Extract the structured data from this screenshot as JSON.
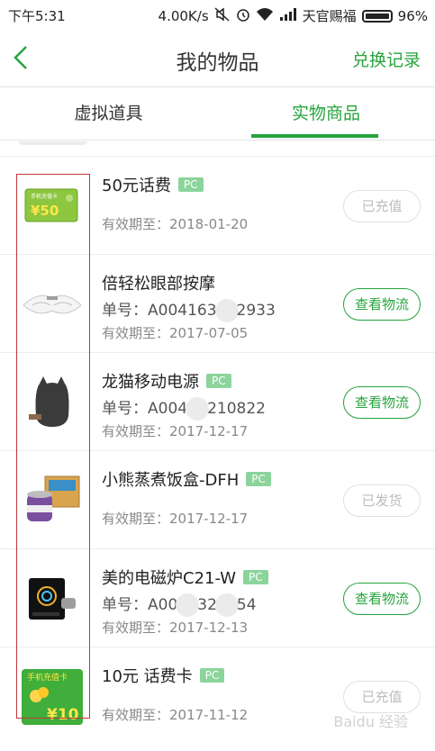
{
  "status_bar": {
    "time": "下午5:31",
    "speed": "4.00K/s",
    "carrier": "天官赐福",
    "battery": "96%"
  },
  "header": {
    "title": "我的物品",
    "right_link": "兑换记录"
  },
  "tabs": [
    {
      "label": "虚拟道具",
      "active": false
    },
    {
      "label": "实物商品",
      "active": true
    }
  ],
  "items": [
    {
      "name": "50元话费",
      "pc_badge": "PC",
      "order_prefix": "",
      "order_suffix": "",
      "expiry": "有效期至：2018-01-20",
      "button": "已充值",
      "button_style": "disabled",
      "icon": "recharge-card-50-icon"
    },
    {
      "name": "倍轻松眼部按摩",
      "pc_badge": "",
      "order_prefix": "单号：A004163",
      "order_suffix": "2933",
      "expiry": "有效期至：2017-07-05",
      "button": "查看物流",
      "button_style": "active",
      "icon": "eye-massager-icon"
    },
    {
      "name": "龙猫移动电源",
      "pc_badge": "PC",
      "order_prefix": "单号：A004",
      "order_suffix": "210822",
      "expiry": "有效期至：2017-12-17",
      "button": "查看物流",
      "button_style": "active",
      "icon": "totoro-power-bank-icon"
    },
    {
      "name": "小熊蒸煮饭盒-DFH",
      "pc_badge": "PC",
      "order_prefix": "",
      "order_suffix": "",
      "expiry": "有效期至：2017-12-17",
      "button": "已发货",
      "button_style": "disabled",
      "icon": "lunch-box-icon"
    },
    {
      "name": "美的电磁炉C21-W",
      "pc_badge": "PC",
      "order_prefix": "单号：A00",
      "order_suffix": "32",
      "order_suffix2": "54",
      "expiry": "有效期至：2017-12-13",
      "button": "查看物流",
      "button_style": "active",
      "icon": "induction-cooker-icon"
    },
    {
      "name": "10元 话费卡",
      "pc_badge": "PC",
      "order_prefix": "",
      "order_suffix": "",
      "expiry": "有效期至：2017-11-12",
      "button": "已充值",
      "button_style": "disabled",
      "icon": "recharge-card-10-icon"
    }
  ],
  "thumb_text": {
    "card50_title": "手机充值卡",
    "card50_value": "¥50",
    "card10_title": "手机充值卡",
    "card10_value": "¥10"
  },
  "watermark": "Baidu 经验",
  "colors": {
    "accent": "#26a43d",
    "badge": "#8bd49b",
    "highlight_box": "#c0393b"
  }
}
